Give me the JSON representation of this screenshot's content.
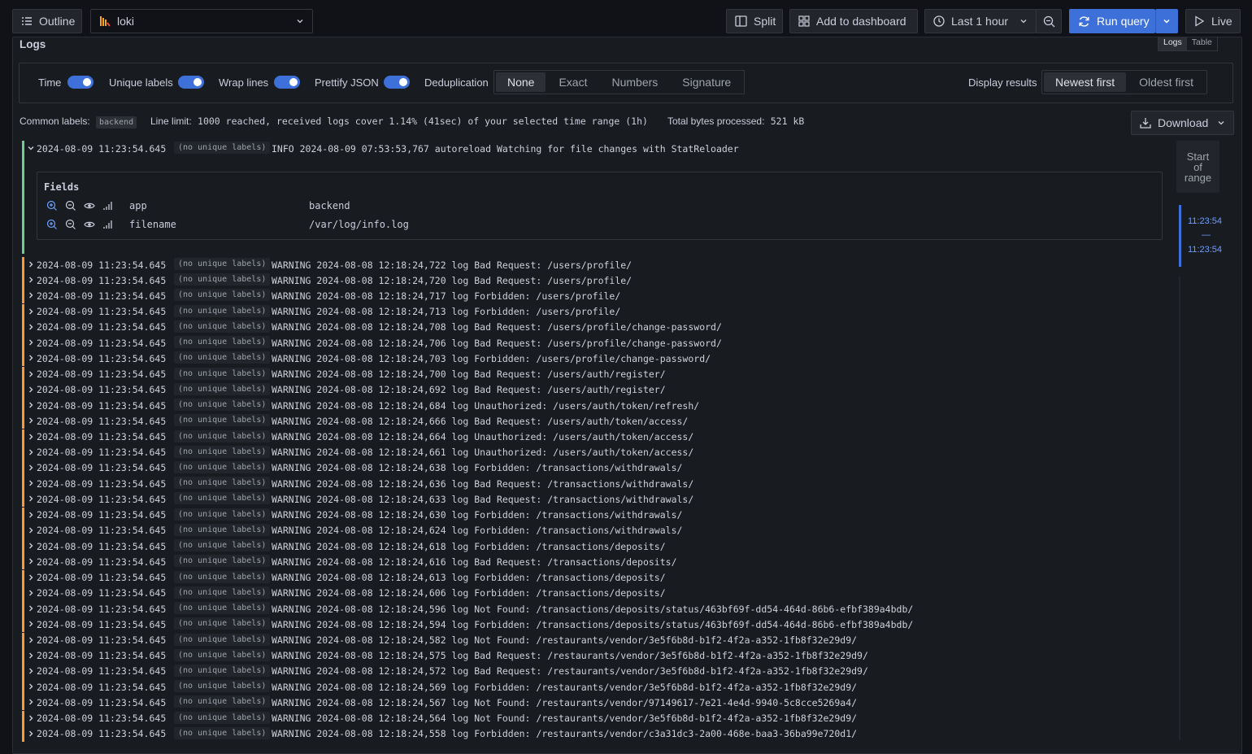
{
  "toolbar": {
    "outline_label": "Outline",
    "datasource": "loki",
    "split_label": "Split",
    "add_dashboard_label": "Add to dashboard",
    "time_range_label": "Last 1 hour",
    "run_query_label": "Run query",
    "live_label": "Live"
  },
  "panel": {
    "title": "Logs",
    "view_tabs": [
      "Logs",
      "Table"
    ]
  },
  "options": {
    "time_label": "Time",
    "unique_labels_label": "Unique labels",
    "wrap_lines_label": "Wrap lines",
    "prettify_label": "Prettify JSON",
    "dedup_label": "Deduplication",
    "dedup_options": [
      "None",
      "Exact",
      "Numbers",
      "Signature"
    ],
    "dedup_selected": "None",
    "display_label": "Display results",
    "order_options": [
      "Newest first",
      "Oldest first"
    ],
    "order_selected": "Newest first",
    "toggles": {
      "time": true,
      "unique_labels": true,
      "wrap_lines": true,
      "prettify_json": true
    }
  },
  "meta": {
    "common_labels_label": "Common labels:",
    "common_labels_value": "backend",
    "line_limit_label": "Line limit:",
    "line_limit_value": "1000 reached, received logs cover 1.14% (41sec) of your selected time range (1h)",
    "bytes_label": "Total bytes processed:",
    "bytes_value": "521 kB"
  },
  "download_label": "Download",
  "expanded": {
    "timestamp": "2024-08-09 11:23:54.645",
    "labels": "(no unique labels)",
    "message": "INFO 2024-08-09 07:53:53,767 autoreload Watching for file changes with StatReloader",
    "fields_title": "Fields",
    "fields": [
      {
        "key": "app",
        "value": "backend"
      },
      {
        "key": "filename",
        "value": "/var/log/info.log"
      }
    ]
  },
  "rows": [
    {
      "ts": "2024-08-09 11:23:54.645",
      "labels": "(no unique labels)",
      "msg": "WARNING 2024-08-08 12:18:24,722 log Bad Request: /users/profile/"
    },
    {
      "ts": "2024-08-09 11:23:54.645",
      "labels": "(no unique labels)",
      "msg": "WARNING 2024-08-08 12:18:24,720 log Bad Request: /users/profile/"
    },
    {
      "ts": "2024-08-09 11:23:54.645",
      "labels": "(no unique labels)",
      "msg": "WARNING 2024-08-08 12:18:24,717 log Forbidden: /users/profile/"
    },
    {
      "ts": "2024-08-09 11:23:54.645",
      "labels": "(no unique labels)",
      "msg": "WARNING 2024-08-08 12:18:24,713 log Forbidden: /users/profile/"
    },
    {
      "ts": "2024-08-09 11:23:54.645",
      "labels": "(no unique labels)",
      "msg": "WARNING 2024-08-08 12:18:24,708 log Bad Request: /users/profile/change-password/"
    },
    {
      "ts": "2024-08-09 11:23:54.645",
      "labels": "(no unique labels)",
      "msg": "WARNING 2024-08-08 12:18:24,706 log Bad Request: /users/profile/change-password/"
    },
    {
      "ts": "2024-08-09 11:23:54.645",
      "labels": "(no unique labels)",
      "msg": "WARNING 2024-08-08 12:18:24,703 log Forbidden: /users/profile/change-password/"
    },
    {
      "ts": "2024-08-09 11:23:54.645",
      "labels": "(no unique labels)",
      "msg": "WARNING 2024-08-08 12:18:24,700 log Bad Request: /users/auth/register/"
    },
    {
      "ts": "2024-08-09 11:23:54.645",
      "labels": "(no unique labels)",
      "msg": "WARNING 2024-08-08 12:18:24,692 log Bad Request: /users/auth/register/"
    },
    {
      "ts": "2024-08-09 11:23:54.645",
      "labels": "(no unique labels)",
      "msg": "WARNING 2024-08-08 12:18:24,684 log Unauthorized: /users/auth/token/refresh/"
    },
    {
      "ts": "2024-08-09 11:23:54.645",
      "labels": "(no unique labels)",
      "msg": "WARNING 2024-08-08 12:18:24,666 log Bad Request: /users/auth/token/access/"
    },
    {
      "ts": "2024-08-09 11:23:54.645",
      "labels": "(no unique labels)",
      "msg": "WARNING 2024-08-08 12:18:24,664 log Unauthorized: /users/auth/token/access/"
    },
    {
      "ts": "2024-08-09 11:23:54.645",
      "labels": "(no unique labels)",
      "msg": "WARNING 2024-08-08 12:18:24,661 log Unauthorized: /users/auth/token/access/"
    },
    {
      "ts": "2024-08-09 11:23:54.645",
      "labels": "(no unique labels)",
      "msg": "WARNING 2024-08-08 12:18:24,638 log Forbidden: /transactions/withdrawals/"
    },
    {
      "ts": "2024-08-09 11:23:54.645",
      "labels": "(no unique labels)",
      "msg": "WARNING 2024-08-08 12:18:24,636 log Bad Request: /transactions/withdrawals/"
    },
    {
      "ts": "2024-08-09 11:23:54.645",
      "labels": "(no unique labels)",
      "msg": "WARNING 2024-08-08 12:18:24,633 log Bad Request: /transactions/withdrawals/"
    },
    {
      "ts": "2024-08-09 11:23:54.645",
      "labels": "(no unique labels)",
      "msg": "WARNING 2024-08-08 12:18:24,630 log Forbidden: /transactions/withdrawals/"
    },
    {
      "ts": "2024-08-09 11:23:54.645",
      "labels": "(no unique labels)",
      "msg": "WARNING 2024-08-08 12:18:24,624 log Forbidden: /transactions/withdrawals/"
    },
    {
      "ts": "2024-08-09 11:23:54.645",
      "labels": "(no unique labels)",
      "msg": "WARNING 2024-08-08 12:18:24,618 log Forbidden: /transactions/deposits/"
    },
    {
      "ts": "2024-08-09 11:23:54.645",
      "labels": "(no unique labels)",
      "msg": "WARNING 2024-08-08 12:18:24,616 log Bad Request: /transactions/deposits/"
    },
    {
      "ts": "2024-08-09 11:23:54.645",
      "labels": "(no unique labels)",
      "msg": "WARNING 2024-08-08 12:18:24,613 log Forbidden: /transactions/deposits/"
    },
    {
      "ts": "2024-08-09 11:23:54.645",
      "labels": "(no unique labels)",
      "msg": "WARNING 2024-08-08 12:18:24,606 log Forbidden: /transactions/deposits/"
    },
    {
      "ts": "2024-08-09 11:23:54.645",
      "labels": "(no unique labels)",
      "msg": "WARNING 2024-08-08 12:18:24,596 log Not Found: /transactions/deposits/status/463bf69f-dd54-464d-86b6-efbf389a4bdb/"
    },
    {
      "ts": "2024-08-09 11:23:54.645",
      "labels": "(no unique labels)",
      "msg": "WARNING 2024-08-08 12:18:24,594 log Forbidden: /transactions/deposits/status/463bf69f-dd54-464d-86b6-efbf389a4bdb/"
    },
    {
      "ts": "2024-08-09 11:23:54.645",
      "labels": "(no unique labels)",
      "msg": "WARNING 2024-08-08 12:18:24,582 log Not Found: /restaurants/vendor/3e5f6b8d-b1f2-4f2a-a352-1fb8f32e29d9/"
    },
    {
      "ts": "2024-08-09 11:23:54.645",
      "labels": "(no unique labels)",
      "msg": "WARNING 2024-08-08 12:18:24,575 log Bad Request: /restaurants/vendor/3e5f6b8d-b1f2-4f2a-a352-1fb8f32e29d9/"
    },
    {
      "ts": "2024-08-09 11:23:54.645",
      "labels": "(no unique labels)",
      "msg": "WARNING 2024-08-08 12:18:24,572 log Bad Request: /restaurants/vendor/3e5f6b8d-b1f2-4f2a-a352-1fb8f32e29d9/"
    },
    {
      "ts": "2024-08-09 11:23:54.645",
      "labels": "(no unique labels)",
      "msg": "WARNING 2024-08-08 12:18:24,569 log Forbidden: /restaurants/vendor/3e5f6b8d-b1f2-4f2a-a352-1fb8f32e29d9/"
    },
    {
      "ts": "2024-08-09 11:23:54.645",
      "labels": "(no unique labels)",
      "msg": "WARNING 2024-08-08 12:18:24,567 log Not Found: /restaurants/vendor/97149617-7e21-4e4d-9940-5c8cce5269a4/"
    },
    {
      "ts": "2024-08-09 11:23:54.645",
      "labels": "(no unique labels)",
      "msg": "WARNING 2024-08-08 12:18:24,564 log Not Found: /restaurants/vendor/3e5f6b8d-b1f2-4f2a-a352-1fb8f32e29d9/"
    },
    {
      "ts": "2024-08-09 11:23:54.645",
      "labels": "(no unique labels)",
      "msg": "WARNING 2024-08-08 12:18:24,558 log Forbidden: /restaurants/vendor/c3a31dc3-2a00-468e-baa3-36ba99e720d1/"
    }
  ],
  "navigation": {
    "start_label": "Start of range",
    "range_from": "11:23:54",
    "range_sep": "—",
    "range_to": "11:23:54"
  },
  "colors": {
    "info": "#6ccf8e",
    "warning": "#ff9830",
    "accent": "#3d71d9"
  }
}
